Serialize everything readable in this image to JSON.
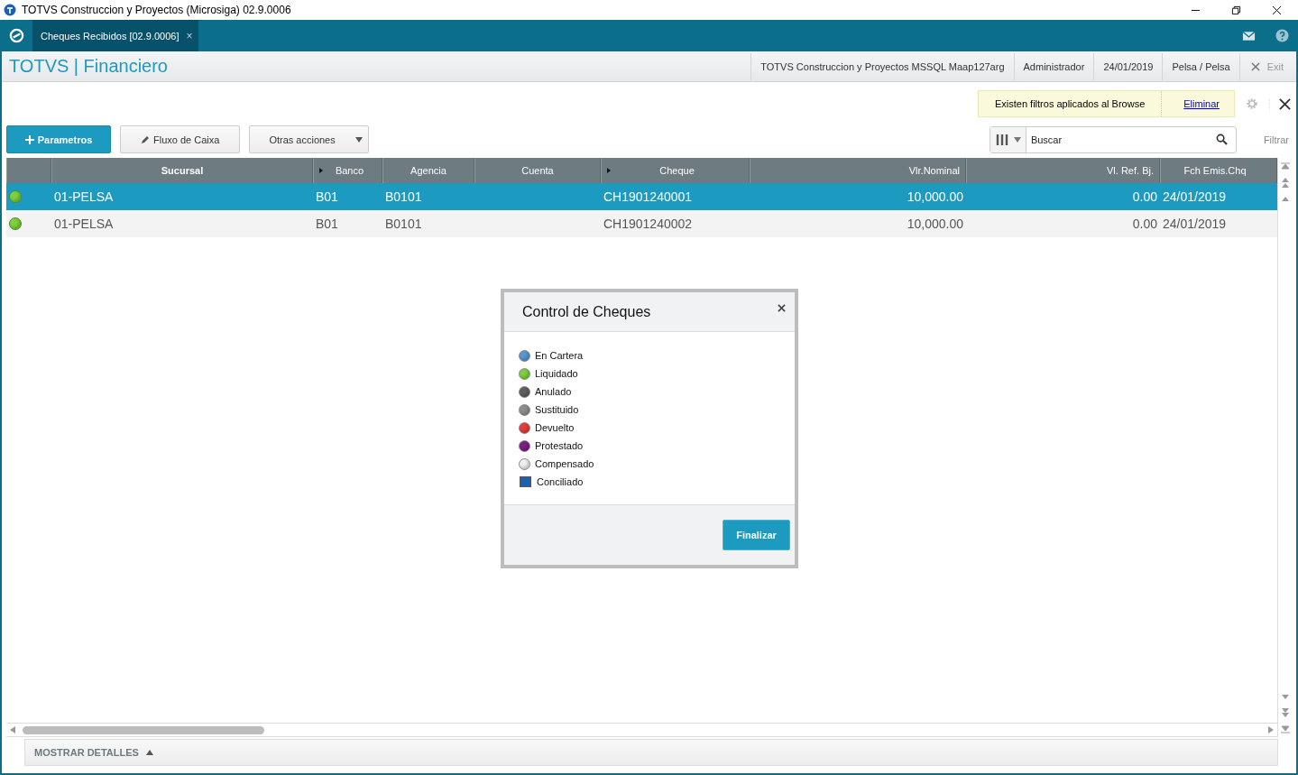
{
  "window": {
    "title": "TOTVS Construccion y Proyectos (Microsiga) 02.9.0006"
  },
  "tabs": [
    {
      "label": "Cheques Recibidos [02.9.0006]",
      "selected": true,
      "close": "×"
    }
  ],
  "header": {
    "brand": "TOTVS",
    "separator": "|",
    "module": "Financiero",
    "info": [
      "TOTVS Construccion y Proyectos MSSQL Maap127arg",
      "Administrador",
      "24/01/2019",
      "Pelsa / Pelsa"
    ],
    "exit": "Exit"
  },
  "filter_notice": {
    "text": "Existen filtros aplicados al Browse",
    "link": "Eliminar"
  },
  "toolbar": [
    {
      "label": "Parametros",
      "kind": "primary"
    },
    {
      "label": "Fluxo de Caixa",
      "kind": "edit"
    },
    {
      "label": "Otras acciones",
      "kind": "menu"
    }
  ],
  "search": {
    "placeholder": "Buscar",
    "filter": "Filtrar"
  },
  "table": {
    "columns": [
      {
        "label": "Sucursal",
        "marker": false
      },
      {
        "label": "Banco",
        "marker": true
      },
      {
        "label": "Agencia",
        "marker": false
      },
      {
        "label": "Cuenta",
        "marker": false
      },
      {
        "label": "Cheque",
        "marker": true
      },
      {
        "label": "Vlr.Nominal",
        "marker": false
      },
      {
        "label": "Vl. Ref. Bj.",
        "marker": false
      },
      {
        "label": "Fch Emis.Chq",
        "marker": false
      }
    ],
    "rows": [
      {
        "selected": true,
        "color": "#7cd13a",
        "cells": [
          "01-PELSA",
          "B01",
          "B0101",
          "",
          "CH1901240001",
          "10,000.00",
          "0.00",
          "24/01/2019"
        ]
      },
      {
        "selected": false,
        "color": "#7cd13a",
        "cells": [
          "01-PELSA",
          "B01",
          "B0101",
          "",
          "CH1901240002",
          "10,000.00",
          "0.00",
          "24/01/2019"
        ]
      }
    ]
  },
  "footer": {
    "label": "MOSTRAR DETALLES"
  },
  "dialog": {
    "title": "Control de Cheques",
    "button": "Finalizar",
    "legend": [
      {
        "label": "En Cartera",
        "color": "#5b95d3",
        "kind": "circle"
      },
      {
        "label": "Liquidado",
        "color": "#7cd13a",
        "kind": "circle"
      },
      {
        "label": "Anulado",
        "color": "#5f5f5f",
        "kind": "circle"
      },
      {
        "label": "Sustituido",
        "color": "#8e8e8e",
        "kind": "circle"
      },
      {
        "label": "Devuelto",
        "color": "#e83b3b",
        "kind": "circle"
      },
      {
        "label": "Protestado",
        "color": "#7a1f85",
        "kind": "circle"
      },
      {
        "label": "Compensado",
        "color": "#f0f0f0",
        "kind": "circle"
      },
      {
        "label": "Conciliado",
        "color": "#1d5fb0",
        "kind": "square"
      }
    ]
  }
}
